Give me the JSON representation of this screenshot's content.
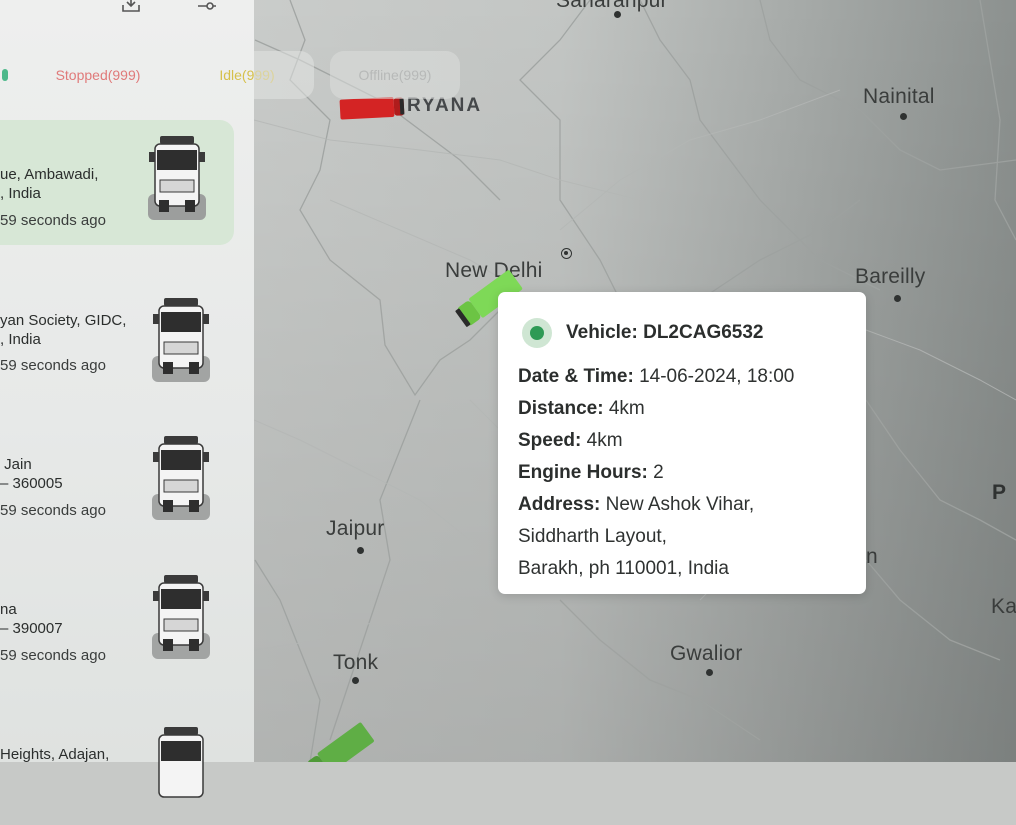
{
  "toolbar": {
    "download_icon": "download-icon",
    "filter_icon": "filter-sliders-icon"
  },
  "filters": {
    "stopped": {
      "label": "Stopped(999)",
      "color": "#e07a7a"
    },
    "idle": {
      "label": "Idle(999)",
      "color": "#d6c04a"
    },
    "offline": {
      "label": "Offline(999)",
      "color": "#b7b9b8"
    }
  },
  "vehicles": [
    {
      "line1": "ue, Ambawadi,",
      "line2": ", India",
      "time": "59 seconds ago"
    },
    {
      "line1": "yan Society, GIDC,",
      "line2": ", India",
      "time": "59 seconds ago"
    },
    {
      "line1": " Jain",
      "line2": "– 360005",
      "time": "59 seconds ago"
    },
    {
      "line1": "na",
      "line2": "– 390007",
      "time": "59 seconds ago"
    },
    {
      "line1": "Heights, Adajan,",
      "line2": "",
      "time": ""
    }
  ],
  "map": {
    "cities": {
      "saharanpur": "Saharanpur",
      "nainital": "Nainital",
      "new_delhi": "New Delhi",
      "bareilly": "Bareilly",
      "jaipur": "Jaipur",
      "tonk": "Tonk",
      "gwalior": "Gwalior",
      "ka": "Ka",
      "p": "P",
      "n": "n"
    },
    "region": "RYANA"
  },
  "popup": {
    "vehicle_label": "Vehicle:",
    "vehicle_id": "DL2CAG6532",
    "date_label": "Date & Time:",
    "date_value": "14-06-2024, 18:00",
    "distance_label": "Distance:",
    "distance_value": "4km",
    "speed_label": "Speed:",
    "speed_value": "4km",
    "engine_label": "Engine Hours:",
    "engine_value": "2",
    "address_label": "Address:",
    "address_line1": "New Ashok Vihar,",
    "address_line2": "Siddharth Layout,",
    "address_line3": "Barakh, ph 110001, India",
    "status_color": "#2e9a55"
  }
}
